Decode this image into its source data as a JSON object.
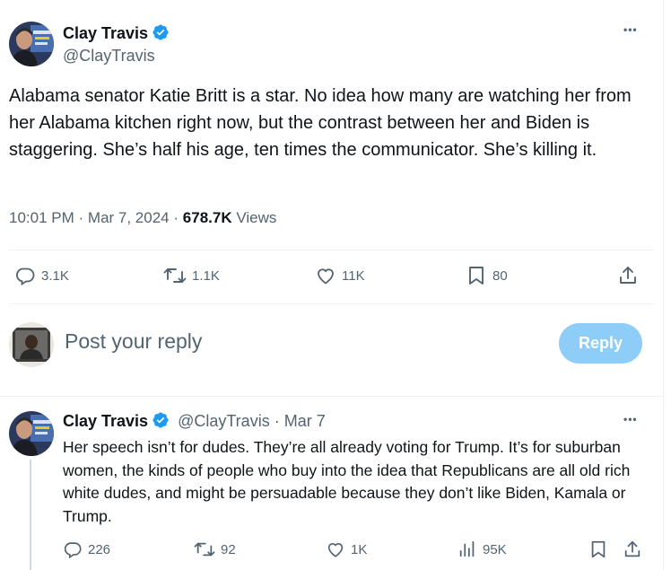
{
  "main_tweet": {
    "author_name": "Clay Travis",
    "author_handle": "@ClayTravis",
    "text": "Alabama senator Katie Britt is a star. No idea how many are watching her from her Alabama kitchen right now, but the contrast between her and Biden is staggering. She’s half his age, ten times the communicator. She’s killing it.",
    "time": "10:01 PM",
    "date": "Mar 7, 2024",
    "sep": "·",
    "views_count": "678.7K",
    "views_label": "Views",
    "replies": "3.1K",
    "reposts": "1.1K",
    "likes": "11K",
    "bookmarks": "80",
    "more": "•••"
  },
  "composer": {
    "placeholder": "Post your reply",
    "button_label": "Reply"
  },
  "reply_tweet": {
    "author_name": "Clay Travis",
    "author_handle": "@ClayTravis",
    "sep": "·",
    "date": "Mar 7",
    "text": "Her speech isn’t for dudes. They’re all already voting for Trump. It’s for suburban women, the kinds of people who buy into the idea that Republicans are all old rich white dudes, and might be persuadable because they don’t like Biden, Kamala or Trump.",
    "replies": "226",
    "reposts": "92",
    "likes": "1K",
    "views": "95K",
    "more": "•••"
  },
  "colors": {
    "verified": "#1d9bf0",
    "reply_button_disabled": "#8ecdf8",
    "secondary_text": "#536471"
  },
  "icons": [
    "verified-badge-icon",
    "more-icon",
    "reply-icon",
    "repost-icon",
    "like-icon",
    "bookmark-icon",
    "share-icon",
    "views-icon"
  ]
}
